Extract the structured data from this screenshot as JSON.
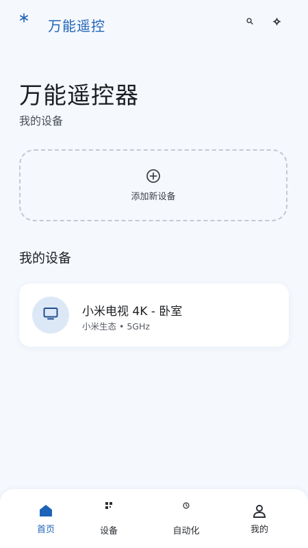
{
  "app_bar": {
    "title": "万能遥控",
    "logo_icon": "asterisk-logo-icon",
    "actions": [
      {
        "icon": "search-icon"
      },
      {
        "icon": "gear-icon"
      }
    ]
  },
  "hero": {
    "title": "万能遥控器",
    "subtitle": "我的设备"
  },
  "add_device": {
    "label": "添加新设备",
    "icon": "add-circle-icon"
  },
  "devices_section": {
    "title": "我的设备",
    "devices": [
      {
        "name": "小米电视 4K - 卧室",
        "meta": "小米生态 • 5GHz",
        "icon": "tv-icon"
      }
    ]
  },
  "bottom_nav": {
    "items": [
      {
        "label": "首页",
        "icon": "home-icon",
        "active": true
      },
      {
        "label": "设备",
        "icon": "devices-icon",
        "active": false
      },
      {
        "label": "自动化",
        "icon": "clock-icon",
        "active": false
      },
      {
        "label": "我的",
        "icon": "person-icon",
        "active": false
      }
    ]
  },
  "colors": {
    "accent": "#1e63b8",
    "background": "#f5f8fd",
    "card": "#ffffff",
    "device_avatar_bg": "#dde8f7"
  }
}
